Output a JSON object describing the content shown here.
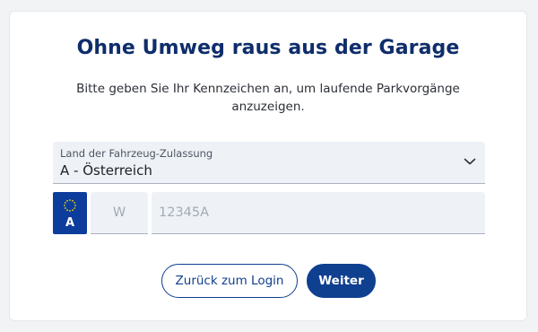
{
  "page": {
    "title": "Ohne Umweg raus aus der Garage",
    "subtitle": "Bitte geben Sie Ihr Kennzeichen an, um laufende Parkvorgänge anzuzeigen."
  },
  "country_select": {
    "label": "Land der Fahrzeug-Zulassung",
    "value": "A - Österreich",
    "icon": "chevron-down-icon"
  },
  "plate": {
    "badge_letter": "A",
    "badge_icon": "eu-stars-icon",
    "district_placeholder": "W",
    "number_placeholder": "12345A"
  },
  "buttons": {
    "back_label": "Zurück zum Login",
    "next_label": "Weiter"
  },
  "colors": {
    "primary": "#0f3f8f",
    "title": "#0f2d6b",
    "field_bg": "#eef2f7",
    "badge": "#0d3d9c",
    "stars": "#f5d300"
  }
}
